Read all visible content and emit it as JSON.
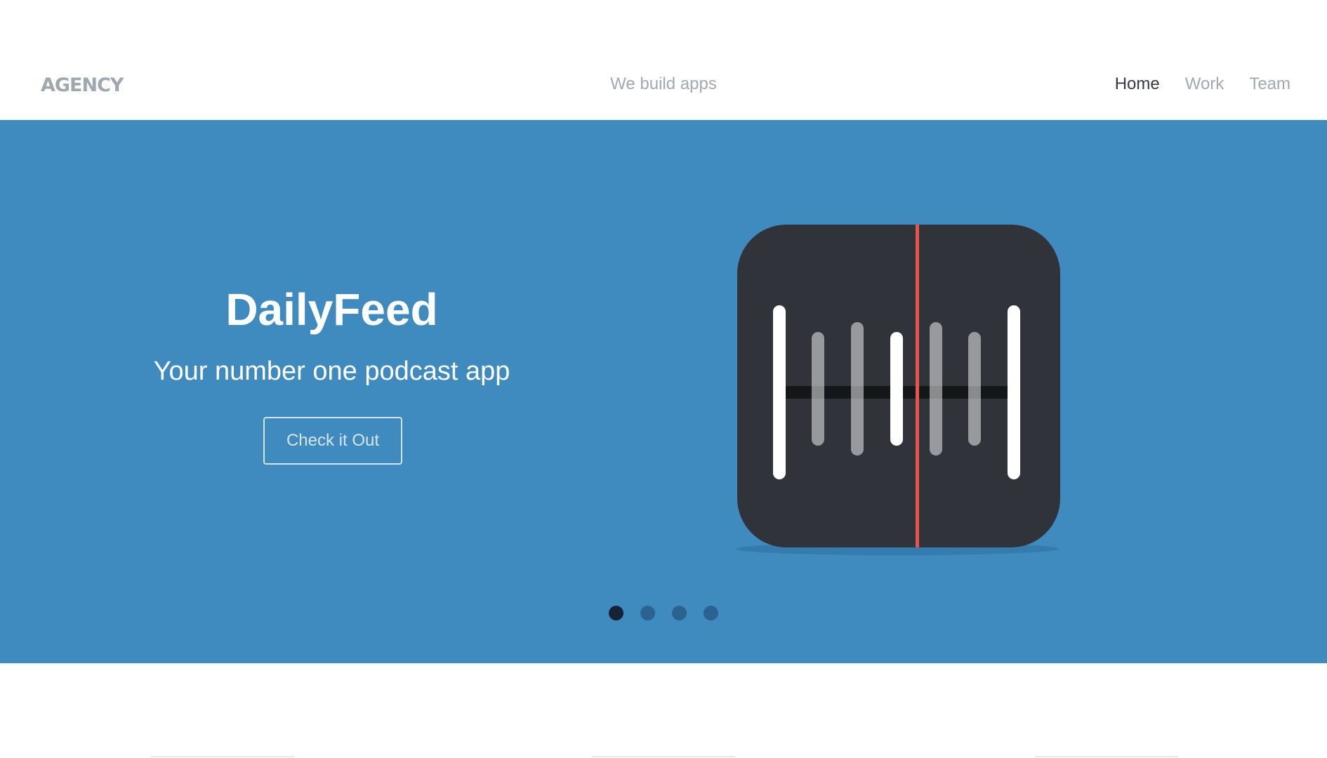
{
  "header": {
    "logo": "AGENCY",
    "tagline": "We build apps",
    "nav": [
      {
        "label": "Home",
        "active": true
      },
      {
        "label": "Work",
        "active": false
      },
      {
        "label": "Team",
        "active": false
      }
    ]
  },
  "hero": {
    "title": "DailyFeed",
    "subtitle": "Your number one podcast app",
    "button_label": "Check it Out",
    "app_icon": "podcast-waveform-icon",
    "carousel": {
      "slide_count": 4,
      "active_index": 0
    }
  },
  "colors": {
    "hero_background": "#3f8abf",
    "icon_background": "#30333a",
    "icon_accent": "#e8524f",
    "nav_active": "#333a42",
    "nav_inactive": "#a3a9b0",
    "dot_active": "#162336",
    "dot_inactive": "#2c6290"
  }
}
